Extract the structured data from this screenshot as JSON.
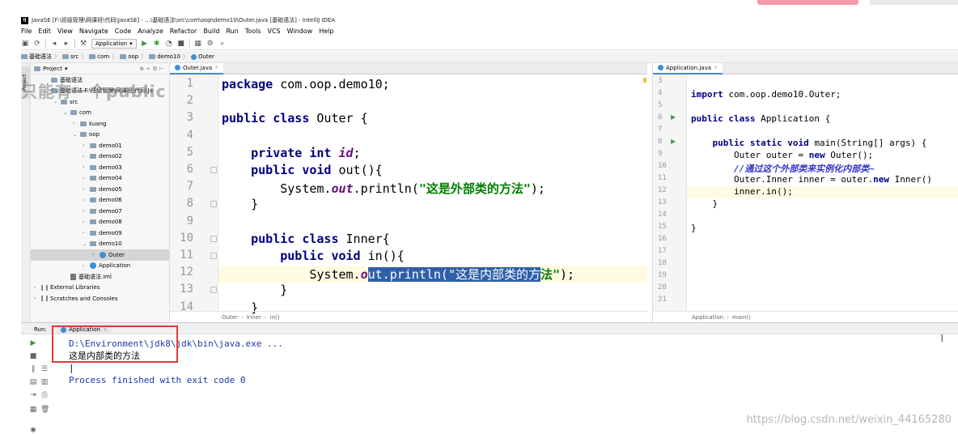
{
  "window": {
    "title": "JavaSE [F:\\班级管理\\网课班\\代码\\JavaSE] - ...\\基础语法\\src\\com\\oop\\demo10\\Outer.java [基础语法] - IntelliJ IDEA",
    "logo_text": "IJ"
  },
  "menu": [
    "File",
    "Edit",
    "View",
    "Navigate",
    "Code",
    "Analyze",
    "Refactor",
    "Build",
    "Run",
    "Tools",
    "VCS",
    "Window",
    "Help"
  ],
  "toolbar": {
    "run_config": "Application"
  },
  "breadcrumb": [
    "基础语法",
    "src",
    "com",
    "oop",
    "demo10",
    "Outer"
  ],
  "overlay_text": "只能有一个public class",
  "project_panel": {
    "title": "Project",
    "tree": [
      {
        "label": "基础语法",
        "indent": 1,
        "arrow": "",
        "icon": "folder"
      },
      {
        "label": "基础语法  F:\\班级管理\\网课班\\代码\\Ja",
        "indent": 1,
        "arrow": "v",
        "icon": "folder"
      },
      {
        "label": "src",
        "indent": 2,
        "arrow": "v",
        "icon": "folder"
      },
      {
        "label": "com",
        "indent": 3,
        "arrow": "v",
        "icon": "folder"
      },
      {
        "label": "kuang",
        "indent": 4,
        "arrow": ">",
        "icon": "folder"
      },
      {
        "label": "oop",
        "indent": 4,
        "arrow": "v",
        "icon": "folder"
      },
      {
        "label": "demo01",
        "indent": 5,
        "arrow": ">",
        "icon": "folder"
      },
      {
        "label": "demo02",
        "indent": 5,
        "arrow": ">",
        "icon": "folder"
      },
      {
        "label": "demo03",
        "indent": 5,
        "arrow": ">",
        "icon": "folder"
      },
      {
        "label": "demo04",
        "indent": 5,
        "arrow": ">",
        "icon": "folder"
      },
      {
        "label": "demo05",
        "indent": 5,
        "arrow": ">",
        "icon": "folder"
      },
      {
        "label": "demo06",
        "indent": 5,
        "arrow": ">",
        "icon": "folder"
      },
      {
        "label": "demo07",
        "indent": 5,
        "arrow": ">",
        "icon": "folder"
      },
      {
        "label": "demo08",
        "indent": 5,
        "arrow": ">",
        "icon": "folder"
      },
      {
        "label": "demo09",
        "indent": 5,
        "arrow": ">",
        "icon": "folder"
      },
      {
        "label": "demo10",
        "indent": 5,
        "arrow": "v",
        "icon": "folder"
      },
      {
        "label": "Outer",
        "indent": 6,
        "arrow": ">",
        "icon": "class",
        "selected": true
      },
      {
        "label": "Application",
        "indent": 5,
        "arrow": ">",
        "icon": "class"
      },
      {
        "label": "基础语法.iml",
        "indent": 3,
        "arrow": "",
        "icon": "iml"
      },
      {
        "label": "External Libraries",
        "indent": 0,
        "arrow": ">",
        "icon": "lib"
      },
      {
        "label": "Scratches and Consoles",
        "indent": 0,
        "arrow": ">",
        "icon": "lib"
      }
    ]
  },
  "editor_left": {
    "tab": "Outer.java",
    "lines": [
      {
        "n": "1",
        "code": [
          {
            "t": "package ",
            "c": "kw"
          },
          {
            "t": "com.oop.demo10;",
            "c": ""
          }
        ]
      },
      {
        "n": "2",
        "code": []
      },
      {
        "n": "3",
        "code": [
          {
            "t": "public class ",
            "c": "kw"
          },
          {
            "t": "Outer {",
            "c": ""
          }
        ]
      },
      {
        "n": "4",
        "code": []
      },
      {
        "n": "5",
        "code": [
          {
            "t": "    private int ",
            "c": "kw"
          },
          {
            "t": "id",
            "c": "fld"
          },
          {
            "t": ";",
            "c": ""
          }
        ]
      },
      {
        "n": "6",
        "code": [
          {
            "t": "    public void ",
            "c": "kw"
          },
          {
            "t": "out(){",
            "c": ""
          }
        ]
      },
      {
        "n": "7",
        "code": [
          {
            "t": "        System.",
            "c": ""
          },
          {
            "t": "out",
            "c": "fld"
          },
          {
            "t": ".println(",
            "c": ""
          },
          {
            "t": "\"这是外部类的方法\"",
            "c": "str"
          },
          {
            "t": ");",
            "c": ""
          }
        ]
      },
      {
        "n": "8",
        "code": [
          {
            "t": "    }",
            "c": ""
          }
        ]
      },
      {
        "n": "9",
        "code": []
      },
      {
        "n": "10",
        "code": [
          {
            "t": "    public class ",
            "c": "kw"
          },
          {
            "t": "Inner{",
            "c": ""
          }
        ]
      },
      {
        "n": "11",
        "code": [
          {
            "t": "        public void ",
            "c": "kw"
          },
          {
            "t": "in(){",
            "c": ""
          }
        ]
      },
      {
        "n": "12",
        "code": [
          {
            "t": "            System.",
            "c": ""
          },
          {
            "t": "o",
            "c": "fld"
          },
          {
            "t": "ut.println(\"这是内部类的方",
            "c": "selhl"
          },
          {
            "t": "法\"",
            "c": "str"
          },
          {
            "t": ");",
            "c": ""
          }
        ]
      },
      {
        "n": "13",
        "code": [
          {
            "t": "        }",
            "c": ""
          }
        ]
      },
      {
        "n": "14",
        "code": [
          {
            "t": "    }",
            "c": ""
          }
        ]
      }
    ],
    "status_crumbs": [
      "Outer",
      "Inner",
      "in()"
    ]
  },
  "editor_right": {
    "tab": "Application.java",
    "lines": [
      {
        "n": "3",
        "code": []
      },
      {
        "n": "4",
        "code": [
          {
            "t": "import ",
            "c": "kw"
          },
          {
            "t": "com.oop.demo10.Outer;",
            "c": ""
          }
        ]
      },
      {
        "n": "5",
        "code": []
      },
      {
        "n": "6",
        "code": [
          {
            "t": "public class ",
            "c": "kw"
          },
          {
            "t": "Application {",
            "c": ""
          }
        ]
      },
      {
        "n": "7",
        "code": []
      },
      {
        "n": "8",
        "code": [
          {
            "t": "    public static void ",
            "c": "kw"
          },
          {
            "t": "main(String[] args) {",
            "c": ""
          }
        ]
      },
      {
        "n": "9",
        "code": [
          {
            "t": "        Outer outer = ",
            "c": ""
          },
          {
            "t": "new ",
            "c": "kw"
          },
          {
            "t": "Outer();",
            "c": ""
          }
        ]
      },
      {
        "n": "10",
        "code": [
          {
            "t": "        //通过这个外部类来实例化内部类~",
            "c": "cmt"
          }
        ]
      },
      {
        "n": "11",
        "code": [
          {
            "t": "        Outer.Inner inner = outer.",
            "c": ""
          },
          {
            "t": "new ",
            "c": "kw"
          },
          {
            "t": "Inner()",
            "c": ""
          }
        ]
      },
      {
        "n": "12",
        "code": [
          {
            "t": "        inner.in();",
            "c": ""
          }
        ]
      },
      {
        "n": "13",
        "code": [
          {
            "t": "    }",
            "c": ""
          }
        ]
      },
      {
        "n": "14",
        "code": []
      },
      {
        "n": "15",
        "code": [
          {
            "t": "}",
            "c": ""
          }
        ]
      },
      {
        "n": "16",
        "code": []
      },
      {
        "n": "17",
        "code": []
      },
      {
        "n": "18",
        "code": []
      },
      {
        "n": "19",
        "code": []
      },
      {
        "n": "20",
        "code": []
      },
      {
        "n": "21",
        "code": []
      }
    ],
    "status_crumbs": [
      "Application",
      "main()"
    ]
  },
  "run_panel": {
    "label": "Run:",
    "tab": "Application",
    "console": {
      "path_line": "D:\\Environment\\jdk8\\jdk\\bin\\java.exe ...",
      "output_line": "这是内部类的方法",
      "finish_line": "Process finished with exit code 0"
    }
  },
  "watermark": "https://blog.csdn.net/weixin_44165280",
  "colors": {
    "keyword": "#000080",
    "string": "#008000",
    "field": "#660e7a",
    "selection": "#2f5fa8",
    "highlight_box": "#e53935"
  }
}
